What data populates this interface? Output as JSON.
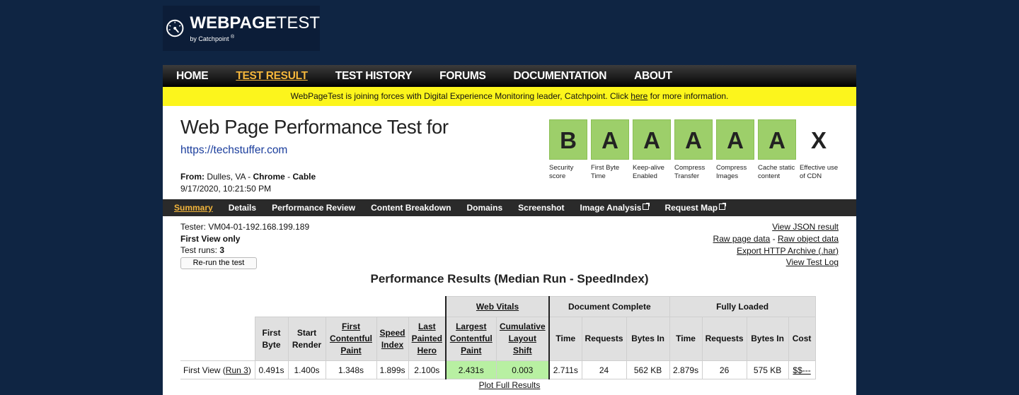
{
  "logo": {
    "title_bold": "WEBPAGE",
    "title_light": "TEST",
    "subtitle": "by Catchpoint",
    "reg": "®"
  },
  "nav": [
    {
      "label": "HOME"
    },
    {
      "label": "TEST RESULT",
      "active": true
    },
    {
      "label": "TEST HISTORY"
    },
    {
      "label": "FORUMS"
    },
    {
      "label": "DOCUMENTATION"
    },
    {
      "label": "ABOUT"
    }
  ],
  "banner": {
    "before": "WebPageTest is joining forces with Digital Experience Monitoring leader, Catchpoint. Click ",
    "link": "here",
    "after": " for more information."
  },
  "header": {
    "title": "Web Page Performance Test for",
    "url": "https://techstuffer.com",
    "from_label": "From:",
    "from_location": "Dulles, VA - ",
    "browser": "Chrome",
    "sep": " - ",
    "connection": "Cable",
    "datetime": "9/17/2020, 10:21:50 PM"
  },
  "grades": [
    {
      "grade": "B",
      "label": "Security score"
    },
    {
      "grade": "A",
      "label": "First Byte Time"
    },
    {
      "grade": "A",
      "label": "Keep-alive Enabled"
    },
    {
      "grade": "A",
      "label": "Compress Transfer"
    },
    {
      "grade": "A",
      "label": "Compress Images"
    },
    {
      "grade": "A",
      "label": "Cache static content"
    },
    {
      "grade": "X",
      "label": "Effective use of CDN"
    }
  ],
  "subnav": [
    {
      "label": "Summary",
      "active": true
    },
    {
      "label": "Details"
    },
    {
      "label": "Performance Review"
    },
    {
      "label": "Content Breakdown"
    },
    {
      "label": "Domains"
    },
    {
      "label": "Screenshot"
    },
    {
      "label": "Image Analysis",
      "external": true
    },
    {
      "label": "Request Map",
      "external": true
    }
  ],
  "info": {
    "tester": "Tester: VM04-01-192.168.199.189",
    "view": "First View only",
    "runs_label": "Test runs: ",
    "runs": "3",
    "rerun": "Re-run the test",
    "json": "View JSON result",
    "raw_page": "Raw page data",
    "dash": " - ",
    "raw_object": "Raw object data",
    "har": "Export HTTP Archive (.har)",
    "log": "View Test Log"
  },
  "results": {
    "title": "Performance Results (Median Run - SpeedIndex)",
    "groups": {
      "web_vitals": "Web Vitals",
      "document": "Document Complete",
      "fully": "Fully Loaded"
    },
    "cols": {
      "first_byte": "First Byte",
      "start_render": "Start Render",
      "fcp": "First Contentful Paint",
      "speed_index": "Speed Index",
      "last_hero": "Last Painted Hero",
      "lcp": "Largest Contentful Paint",
      "cls": "Cumulative Layout Shift",
      "doc_time": "Time",
      "doc_requests": "Requests",
      "doc_bytes": "Bytes In",
      "fl_time": "Time",
      "fl_requests": "Requests",
      "fl_bytes": "Bytes In",
      "cost": "Cost"
    },
    "row": {
      "label_pre": "First View (",
      "run_link": "Run 3",
      "label_post": ")",
      "first_byte": "0.491s",
      "start_render": "1.400s",
      "fcp": "1.348s",
      "speed_index": "1.899s",
      "last_hero": "2.100s",
      "lcp": "2.431s",
      "cls": "0.003",
      "doc_time": "2.711s",
      "doc_requests": "24",
      "doc_bytes": "562 KB",
      "fl_time": "2.879s",
      "fl_requests": "26",
      "fl_bytes": "575 KB",
      "cost": "$$---"
    },
    "plot": "Plot Full Results"
  }
}
